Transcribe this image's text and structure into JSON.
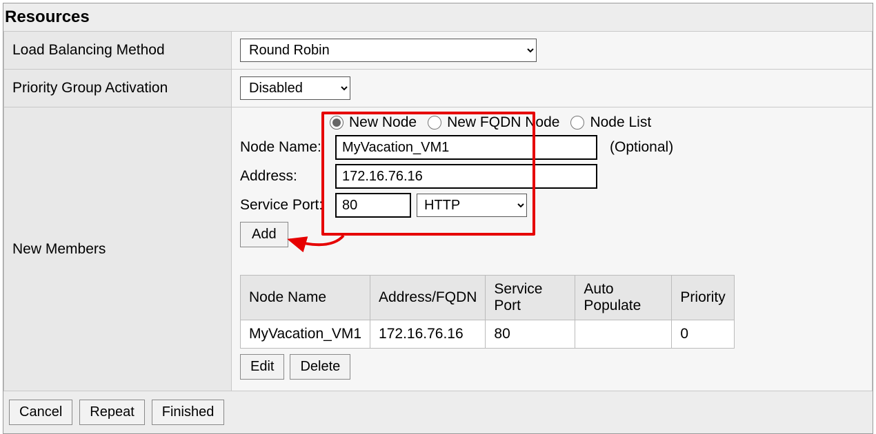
{
  "section": {
    "title": "Resources"
  },
  "rows": {
    "lb_method": {
      "label": "Load Balancing Method",
      "value": "Round Robin"
    },
    "pga": {
      "label": "Priority Group Activation",
      "value": "Disabled"
    },
    "new_members": {
      "label": "New Members"
    }
  },
  "radios": {
    "new_node": "New Node",
    "new_fqdn": "New FQDN Node",
    "node_list": "Node List"
  },
  "fields": {
    "node_name": {
      "label": "Node Name:",
      "value": "MyVacation_VM1",
      "hint": "(Optional)"
    },
    "address": {
      "label": "Address:",
      "value": "172.16.76.16"
    },
    "service_port": {
      "label": "Service Port:",
      "value": "80",
      "select": "HTTP"
    }
  },
  "buttons": {
    "add": "Add",
    "edit": "Edit",
    "delete": "Delete",
    "cancel": "Cancel",
    "repeat": "Repeat",
    "finished": "Finished"
  },
  "members_table": {
    "headers": {
      "node_name": "Node Name",
      "address": "Address/FQDN",
      "service_port": "Service Port",
      "auto_populate": "Auto Populate",
      "priority": "Priority"
    },
    "row": {
      "node_name": "MyVacation_VM1",
      "address": "172.16.76.16",
      "service_port": "80",
      "auto_populate": "",
      "priority": "0"
    }
  }
}
